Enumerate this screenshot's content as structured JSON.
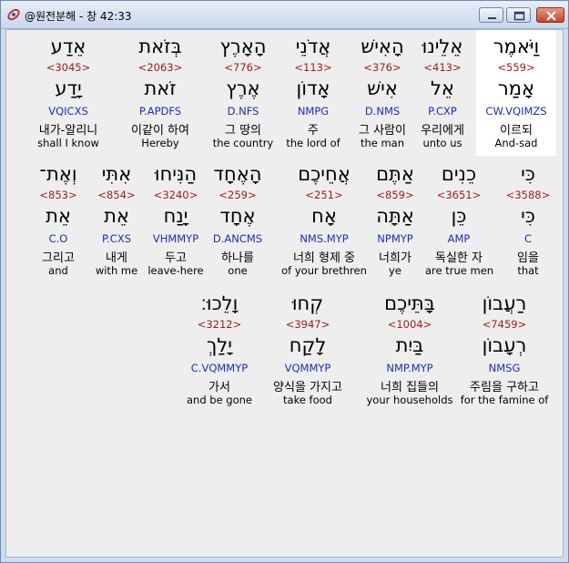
{
  "window": {
    "title": "@원전분해 - 창 42:33"
  },
  "rows": [
    [
      {
        "heb": "וַיֹּאמֶר",
        "num": "<559>",
        "root": "אָמַר",
        "parse": "CW.VQIMZS",
        "kor": "이르되",
        "eng": "And-sad",
        "highlight": true
      },
      {
        "heb": "אֵלֵינוּ",
        "num": "<413>",
        "root": "אֵל",
        "parse": "P.CXP",
        "kor": "우리에게",
        "eng": "unto us"
      },
      {
        "heb": "הָאִישׁ",
        "num": "<376>",
        "root": "אִישׁ",
        "parse": "D.NMS",
        "kor": "그 사람이",
        "eng": "the man"
      },
      {
        "heb": "אֲדֹנֵי",
        "num": "<113>",
        "root": "אָדוֹן",
        "parse": "NMPG",
        "kor": "주",
        "eng": "the lord of"
      },
      {
        "heb": "הָאָרֶץ",
        "num": "<776>",
        "root": "אֶרֶץ",
        "parse": "D.NFS",
        "kor": "그 땅의",
        "eng": "the country"
      },
      {
        "heb": "בְּזֹאת",
        "num": "<2063>",
        "root": "זֹאת",
        "parse": "P.APDFS",
        "kor": "이같이 하여",
        "eng": "Hereby"
      },
      {
        "heb": "אֵדַע",
        "num": "<3045>",
        "root": "יָדַע",
        "parse": "VQICXS",
        "kor": "내가-알리니",
        "eng": "shall I know"
      }
    ],
    [
      {
        "heb": "כִּי",
        "num": "<3588>",
        "root": "כִּי",
        "parse": "C",
        "kor": "임을",
        "eng": "that"
      },
      {
        "heb": "כֵנִים",
        "num": "<3651>",
        "root": "כֵּן",
        "parse": "AMP",
        "kor": "독실한 자",
        "eng": "are true men"
      },
      {
        "heb": "אַתֶּם",
        "num": "<859>",
        "root": "אַתָּה",
        "parse": "NPMYP",
        "kor": "너희가",
        "eng": "ye"
      },
      {
        "heb": "אֲחֵיכֶם",
        "num": "<251>",
        "root": "אָח",
        "parse": "NMS.MYP",
        "kor": "너희 형제 중",
        "eng": "of your brethren"
      },
      {
        "heb": "הָאֶחָד",
        "num": "<259>",
        "root": "אֶחָד",
        "parse": "D.ANCMS",
        "kor": "하나를",
        "eng": "one"
      },
      {
        "heb": "הַנִּיחוּ",
        "num": "<3240>",
        "root": "יָנַח",
        "parse": "VHMMYP",
        "kor": "두고",
        "eng": "leave-here"
      },
      {
        "heb": "אִתִּי",
        "num": "<854>",
        "root": "אֵת",
        "parse": "P.CXS",
        "kor": "내게",
        "eng": "with me"
      },
      {
        "heb": "וְאֶת־",
        "num": "<853>",
        "root": "אֵת",
        "parse": "C.O",
        "kor": "그리고",
        "eng": "and"
      }
    ],
    [
      {
        "heb": "רַעֲבוֹן",
        "num": "<7459>",
        "root": "רְעָבוֹן",
        "parse": "NMSG",
        "kor": "주림을 구하고",
        "eng": "for the famine of"
      },
      {
        "heb": "בָּתֵּיכֶם",
        "num": "<1004>",
        "root": "בַּיִת",
        "parse": "NMP.MYP",
        "kor": "너희 집들의",
        "eng": "your households"
      },
      {
        "heb": "קְחוּ",
        "num": "<3947>",
        "root": "לָקַח",
        "parse": "VQMMYP",
        "kor": "양식을 가지고",
        "eng": "take food"
      },
      {
        "heb": "וָלֵכוּ׃",
        "num": "<3212>",
        "root": "יָלַךְ",
        "parse": "C.VQMMYP",
        "kor": "가서",
        "eng": "and be gone"
      }
    ]
  ]
}
